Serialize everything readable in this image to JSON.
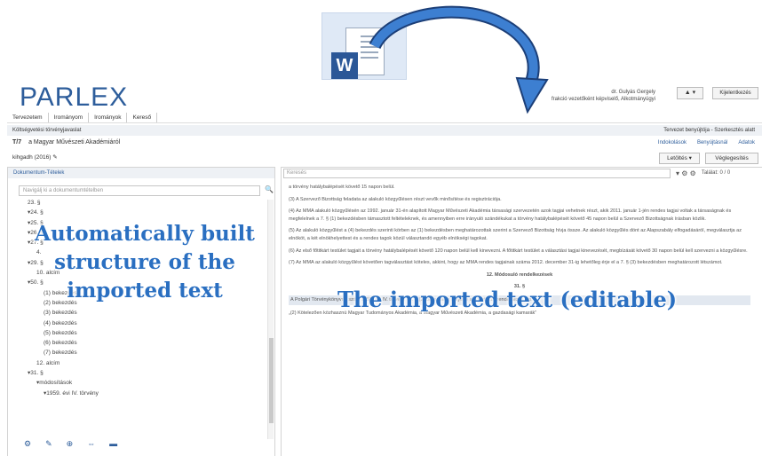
{
  "app": {
    "logo": "PARLEX",
    "user_name": "dr. Gulyás Gergely",
    "user_role": "frakció vezetőként képviselő, Alkotmányügyi",
    "user_button": "▲ ▾",
    "logout": "Kijelentkezés"
  },
  "menu": [
    "Tervezetem",
    "Irományom",
    "Irományok",
    "Kereső"
  ],
  "bar2": {
    "left": "Költségvetési törvényjavaslat",
    "right": "Tervezet benyújtója - Szerkesztés alatt"
  },
  "doc": {
    "id": "T/7",
    "title": "a Magyar Művészeti Akadémiáról",
    "date": "kihgadh (2016)"
  },
  "right_tabs": [
    "Indokolások",
    "Benyújtásnál",
    "Adatok"
  ],
  "buttons": {
    "letoltes": "Letöltés ▾",
    "vegleges": "Véglegesítés"
  },
  "left_panel": {
    "title": "Dokumentum-Tételek",
    "search_placeholder": "Navigálj ki a dokumentumtételben",
    "tree": [
      "23. §",
      "▾24. §",
      "▾25. §",
      "▾26. §",
      "▾27. §",
      "4.",
      "▾29. §",
      "10. alcím",
      "▾50. §",
      "(1) bekezdés",
      "(2) bekezdés",
      "(3) bekezdés",
      "(4) bekezdés",
      "(5) bekezdés",
      "(6) bekezdés",
      "(7) bekezdés",
      "12. alcím",
      "▾31. §",
      "▾módosítások",
      "▾1959. évi IV. törvény"
    ]
  },
  "right_panel": {
    "select_placeholder": "Keresés",
    "counter": "Találat: 0 / 0",
    "paragraphs": [
      "a törvény hatálybalépését követő 15 napon belül.",
      "(3) A Szervező Bizottság feladata az alakuló közgyűlésen részt vevők minősítése és regisztrációja.",
      "(4) Az MMA alakuló közgyűlésén az 1992. január 31-én alapított Magyar Művészeti Akadémia társasági szervezetén azok tagjai vehetnek részt, akik 2011. január 1-jén rendes tagjai voltak a társaságnak és megfelelnek a 7. § (1) bekezdésben támasztott feltételeknek, és amennyiben erre irányuló szándékukat a törvény hatálybalépését követő 45 napon belül a Szervező Bizottságnak írásban közlik.",
      "(5) Az alakuló közgyűlést a (4) bekezdés szerinti körben az (1) bekezdésben meghatározottak szerint a Szervező Bizottság hívja össze. Az alakuló közgyűlés dönt az Alapszabály elfogadásáról, megválasztja az elnököt, a két elnökhelyettest és a rendes tagok közül választandó egyéb elnökségi tagokat.",
      "(6) Az első főtitkárt testület tagjait a törvény hatálybalépését követő 120 napon belül kell kinevezni. A főtitkárt testület a választási tagjai kinevezését, megbízását követő 30 napon belül kell szervezni a közgyűlésre.",
      "(7) Az MMA az alakuló közgyűlést követően tagválasztást köteles, akkint, hogy az MMA rendes tagjainak száma 2012. december 31-ig lehetőleg érje el a 7. § (3) bekezdésben meghatározott létszámot.",
      "A Polgári Törvénykönyvről szóló 1959. évi IV. törvény 63. § (2) bekezdése helyébe a következő rendelkezés lép:",
      "„(2) Kötelezően közhasznú Magyar Tudományos Akadémia, a Magyar Művészeti Akadémia, a gazdasági kamarák”"
    ],
    "heading1": "12. Módosuló rendelkezések",
    "heading2": "31. §"
  },
  "captions": {
    "left": "Automatically built structure of the imported text",
    "right": "The imported text (editable)"
  },
  "icons": {
    "word": "word-document-icon",
    "arrow": "curved-arrow-icon"
  },
  "colors": {
    "brand": "#2d5d9b",
    "caption": "#2a6fc1"
  }
}
